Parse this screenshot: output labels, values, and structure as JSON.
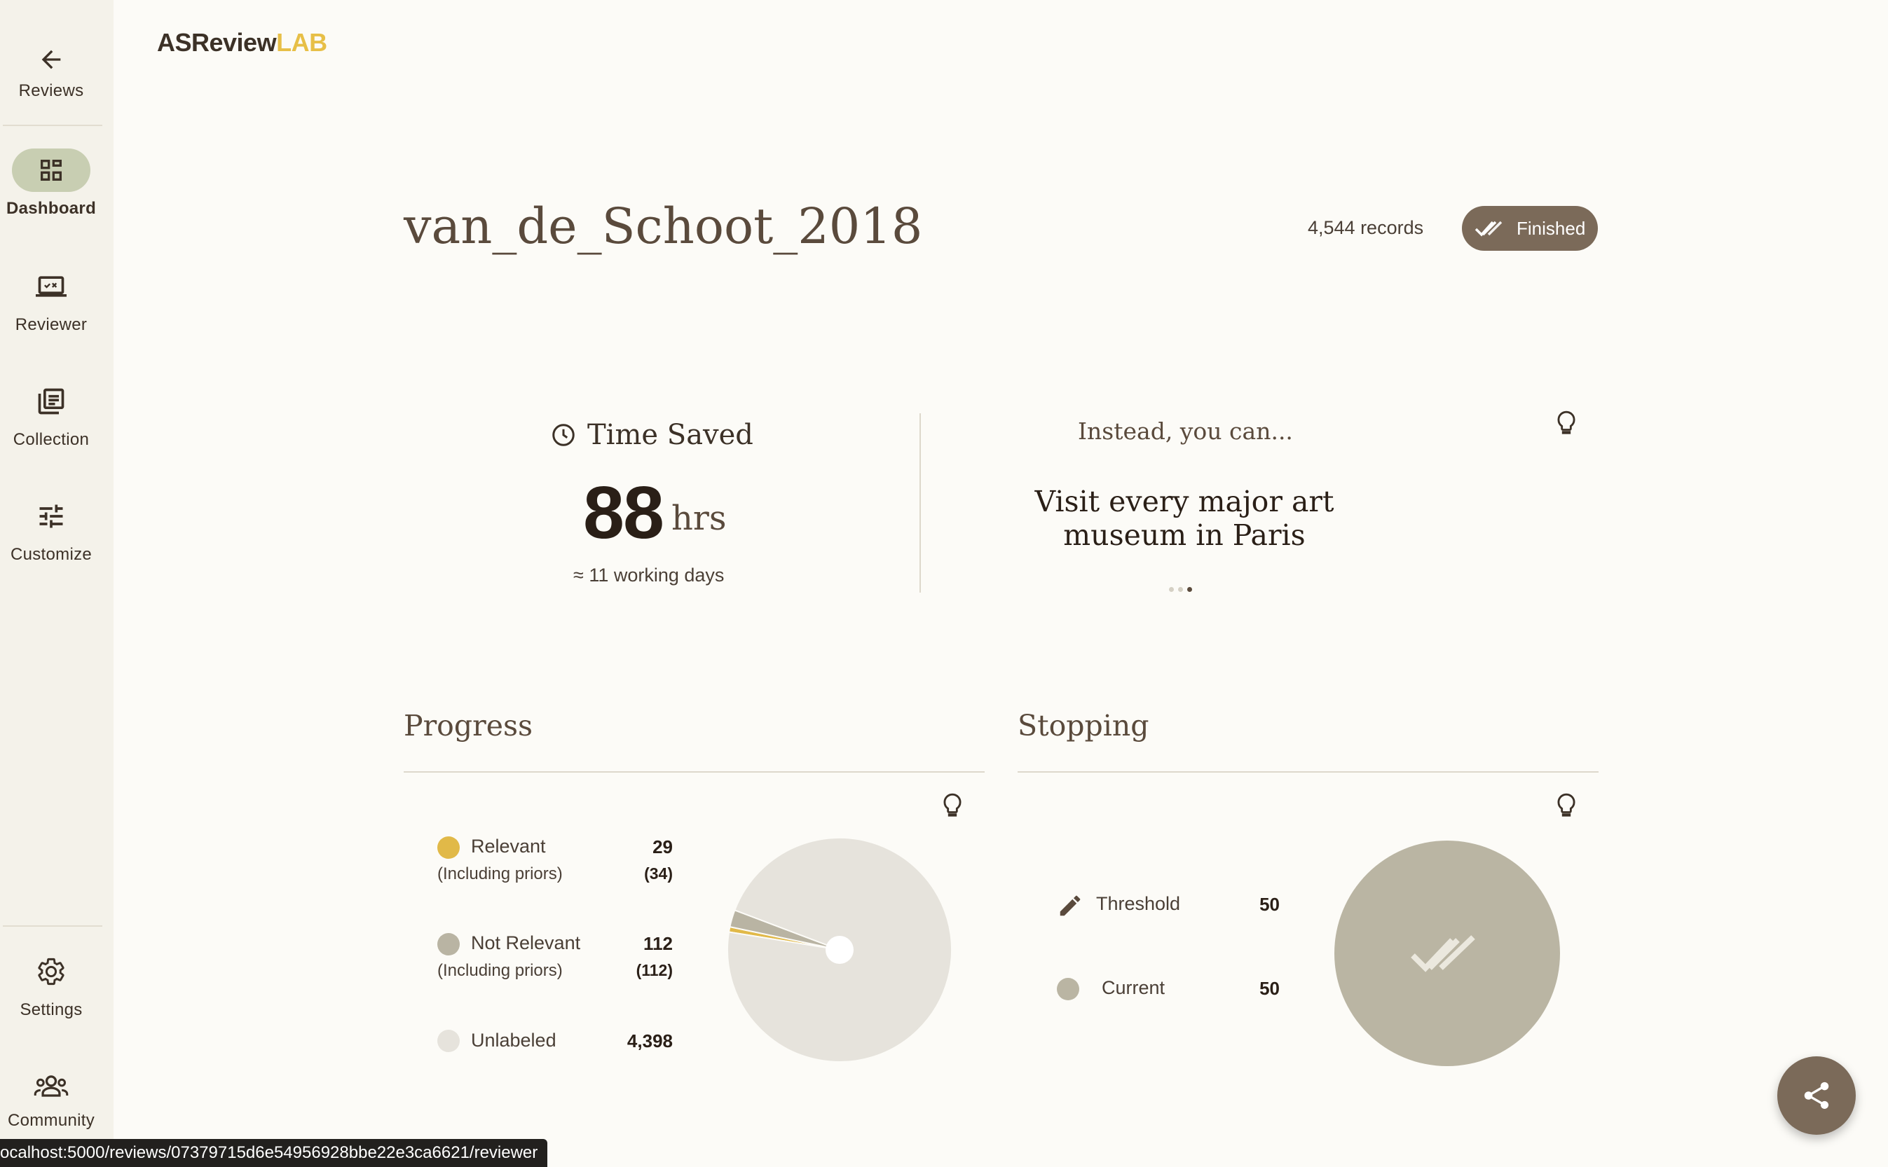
{
  "app": {
    "logo_main": "ASReview",
    "logo_accent": "LAB"
  },
  "sidebar": {
    "back": {
      "label": "Reviews",
      "icon": "arrow-left-icon"
    },
    "items": [
      {
        "label": "Dashboard",
        "icon": "dashboard-icon",
        "active": true
      },
      {
        "label": "Reviewer",
        "icon": "reviewer-icon"
      },
      {
        "label": "Collection",
        "icon": "collection-icon"
      },
      {
        "label": "Customize",
        "icon": "tune-icon"
      }
    ],
    "bottom": [
      {
        "label": "Settings",
        "icon": "gear-icon"
      },
      {
        "label": "Community",
        "icon": "community-icon"
      }
    ]
  },
  "project": {
    "title": "van_de_Schoot_2018",
    "records": "4,544 records",
    "status": "Finished"
  },
  "time_saved": {
    "heading": "Time Saved",
    "value": "88",
    "unit": "hrs",
    "sub": "≈ 11 working days"
  },
  "instead": {
    "heading": "Instead, you can...",
    "body": "Visit every major art museum in Paris",
    "dots_total": 3,
    "dots_active": 3
  },
  "progress": {
    "title": "Progress",
    "legend": [
      {
        "label": "Relevant",
        "sub": "(Including priors)",
        "value": "29",
        "value2": "(34)",
        "color": "#e1b948"
      },
      {
        "label": "Not Relevant",
        "sub": "(Including priors)",
        "value": "112",
        "value2": "(112)",
        "color": "#b9b4a3"
      },
      {
        "label": "Unlabeled",
        "sub": "",
        "value": "4,398",
        "value2": "",
        "color": "#e6e3dc"
      }
    ],
    "chart_data": {
      "type": "pie",
      "labels": [
        "Relevant",
        "Not Relevant",
        "Unlabeled"
      ],
      "values": [
        34,
        112,
        4398
      ],
      "colors": [
        "#e1b948",
        "#b9b4a3",
        "#e6e3dc"
      ]
    }
  },
  "stopping": {
    "title": "Stopping",
    "threshold_label": "Threshold",
    "threshold_value": "50",
    "current_label": "Current",
    "current_value": "50",
    "colors": {
      "circle": "#bab5a3"
    }
  },
  "statusbar": {
    "url": "ocalhost:5000/reviews/07379715d6e54956928bbe22e3ca6621/reviewer"
  },
  "colors": {
    "accent": "#e7bf47",
    "brown": "#7b6a59",
    "sidebar": "#f4f2ea",
    "background": "#fcfbf7"
  }
}
